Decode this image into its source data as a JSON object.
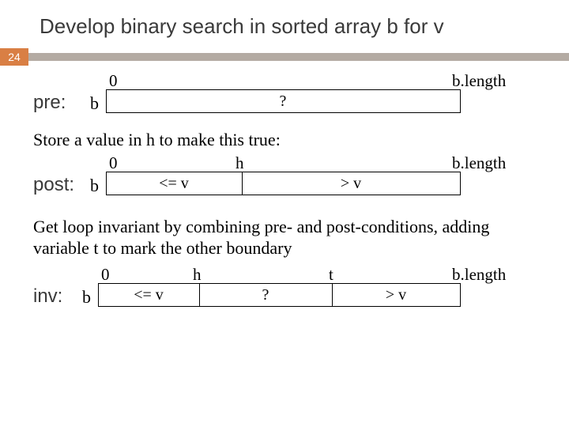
{
  "title": "Develop binary search in sorted array b for v",
  "slide_number": "24",
  "pre": {
    "label": "pre:",
    "array": "b",
    "left": "0",
    "right": "b.length",
    "cell0": "?"
  },
  "store_text": "Store a value in h to make this true:",
  "post": {
    "label": "post:",
    "array": "b",
    "left": "0",
    "mid": "h",
    "right": "b.length",
    "cell0": "<= v",
    "cell1": "> v"
  },
  "inv_text": "Get loop invariant by combining pre- and post-conditions, adding variable t to mark the other boundary",
  "inv": {
    "label": "inv:",
    "array": "b",
    "left": "0",
    "mid1": "h",
    "mid2": "t",
    "right": "b.length",
    "cell0": "<= v",
    "cell1": "?",
    "cell2": "> v"
  }
}
